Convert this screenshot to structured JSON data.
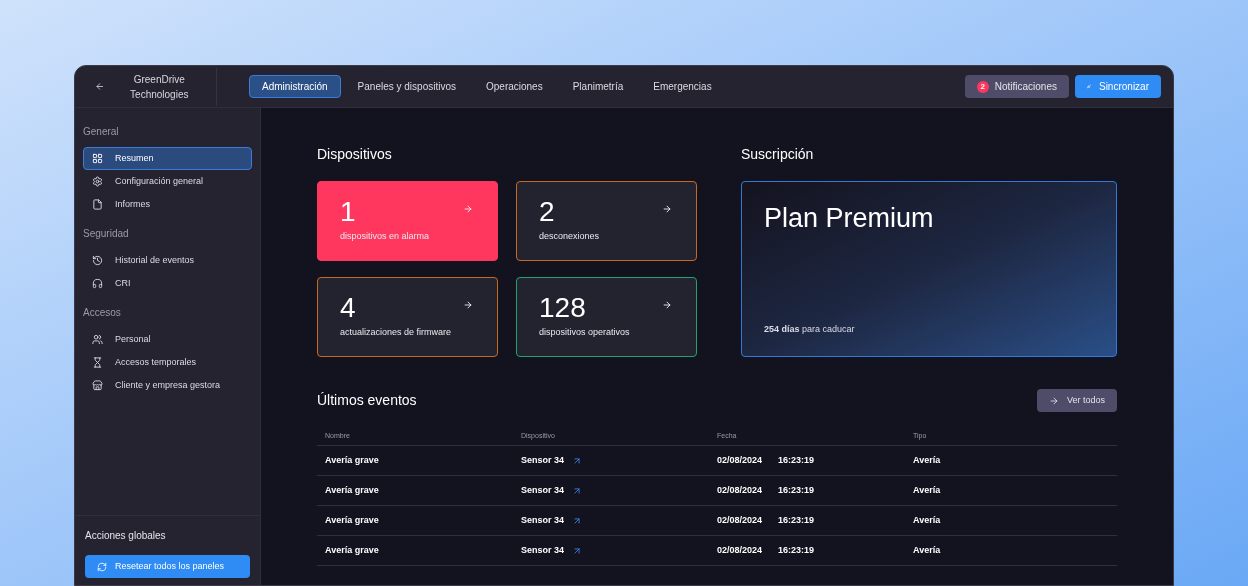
{
  "topbar": {
    "back_label": "GreenDrive Technologies",
    "tabs": [
      {
        "label": "Administración",
        "selected": true
      },
      {
        "label": "Paneles y dispositivos",
        "selected": false
      },
      {
        "label": "Operaciones",
        "selected": false
      },
      {
        "label": "Planimetría",
        "selected": false
      },
      {
        "label": "Emergencias",
        "selected": false
      }
    ],
    "notifications": {
      "label": "Notificaciones",
      "count": "2"
    },
    "sync_button": "Sincronizar"
  },
  "sidebar": {
    "sections": [
      {
        "title": "General",
        "items": [
          {
            "label": "Resumen",
            "selected": true
          },
          {
            "label": "Configuración general",
            "selected": false
          },
          {
            "label": "Informes",
            "selected": false
          }
        ]
      },
      {
        "title": "Seguridad",
        "items": [
          {
            "label": "Historial de eventos",
            "selected": false
          },
          {
            "label": "CRI",
            "selected": false
          }
        ]
      },
      {
        "title": "Accesos",
        "items": [
          {
            "label": "Personal",
            "selected": false
          },
          {
            "label": "Accesos temporales",
            "selected": false
          },
          {
            "label": "Cliente y empresa gestora",
            "selected": false
          }
        ]
      }
    ],
    "footer": {
      "title": "Acciones globales",
      "button": "Resetear todos los paneles"
    }
  },
  "devices": {
    "title": "Dispositivos",
    "cards": [
      {
        "value": "1",
        "label": "dispositivos en alarma",
        "kind": "alarm"
      },
      {
        "value": "2",
        "label": "desconexiones",
        "kind": "warning"
      },
      {
        "value": "4",
        "label": "actualizaciones de firmware",
        "kind": "warning"
      },
      {
        "value": "128",
        "label": "dispositivos operativos",
        "kind": "ok"
      }
    ]
  },
  "subscription": {
    "title": "Suscripción",
    "plan": "Plan Premium",
    "expiry": "**254 días** para caducar"
  },
  "events": {
    "title": "Últimos eventos",
    "view_all": "Ver todos",
    "columns": [
      "Nombre",
      "Dispositivo",
      "Fecha",
      "Tipo"
    ],
    "rows": [
      {
        "name": "Avería grave",
        "device": "Sensor 34",
        "date": "02/08/2024",
        "time": "16:23:19",
        "type": "Avería"
      },
      {
        "name": "Avería grave",
        "device": "Sensor 34",
        "date": "02/08/2024",
        "time": "16:23:19",
        "type": "Avería"
      },
      {
        "name": "Avería grave",
        "device": "Sensor 34",
        "date": "02/08/2024",
        "time": "16:23:19",
        "type": "Avería"
      },
      {
        "name": "Avería grave",
        "device": "Sensor 34",
        "date": "02/08/2024",
        "time": "16:23:19",
        "type": "Avería"
      }
    ]
  }
}
